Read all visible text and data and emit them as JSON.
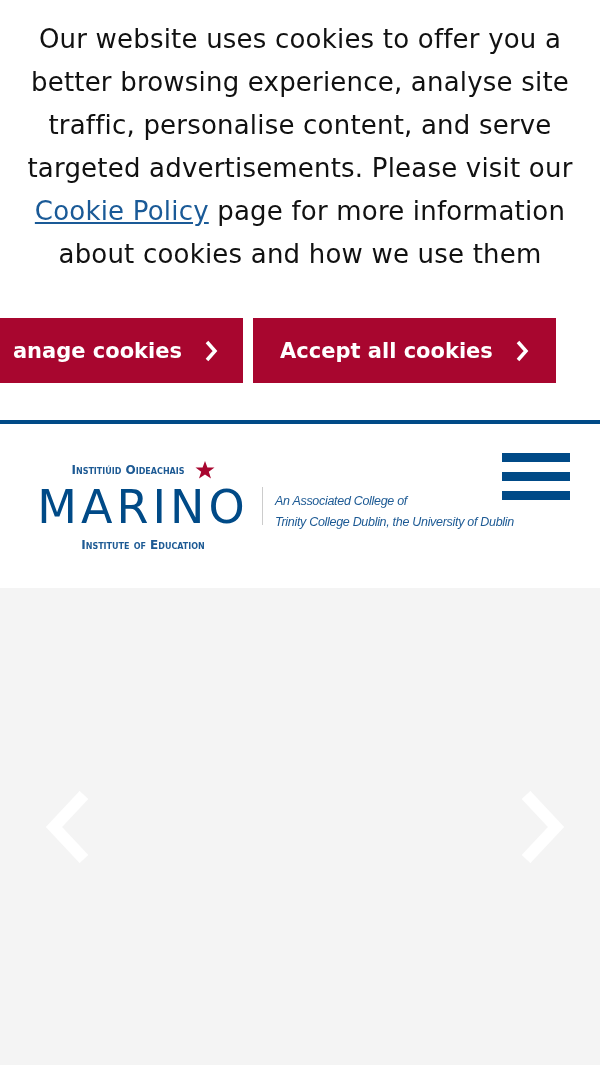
{
  "cookie_banner": {
    "text_before": "Our website uses cookies to offer you a better browsing experience, analyse site traffic, personalise content, and serve targeted advertisements. Please visit our",
    "link": "Cookie Policy",
    "text_after": "page for more information about cookies and how we use them",
    "buttons": [
      {
        "label": "anage cookies"
      },
      {
        "label": "Accept all cookies"
      }
    ]
  },
  "header": {
    "logo_top": "Institiúid Oideachais",
    "logo_name": "MARINO",
    "logo_bottom": "Institute of Education",
    "affiliation_lines": [
      "An Associated College of",
      "Trinity College Dublin, the University of Dublin"
    ]
  }
}
